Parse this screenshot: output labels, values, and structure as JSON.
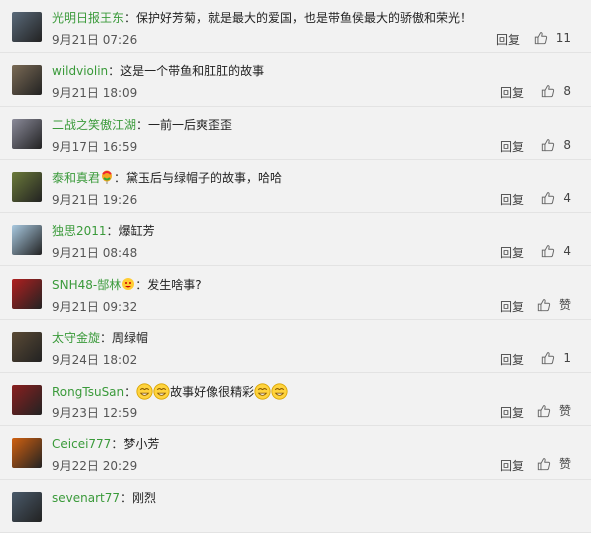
{
  "comments": [
    {
      "user": "光明日报王东",
      "sep": "：",
      "text": "保护好芳菊，就是最大的爱国，也是带鱼侯最大的骄傲和荣光！",
      "time": "9月21日 07:26",
      "reply": "回复",
      "likes": "11",
      "avatar_color": "#5a6a7a"
    },
    {
      "user": "wildviolin",
      "sep": "：",
      "text": "这是一个带鱼和肛肛的故事",
      "time": "9月21日 18:09",
      "reply": "回复",
      "likes": "8",
      "avatar_color": "#7a6a55"
    },
    {
      "user": "二战之笑傲江湖",
      "sep": "：",
      "text": "一前一后爽歪歪",
      "time": "9月17日 16:59",
      "reply": "回复",
      "likes": "8",
      "avatar_color": "#8a8a99"
    },
    {
      "user": "泰和真君",
      "sep": "：",
      "text": "黛玉后与绿帽子的故事，哈哈",
      "time": "9月21日 19:26",
      "reply": "回复",
      "likes": "4",
      "avatar_color": "#6b7a3a",
      "badge": "balloon-badge-icon"
    },
    {
      "user": "独思2011",
      "sep": "：",
      "text": "爆缸芳",
      "time": "9月21日 08:48",
      "reply": "回复",
      "likes": "4",
      "avatar_color": "#a9c9e0"
    },
    {
      "user": "SNH48-郜林",
      "sep": "：",
      "text": "发生啥事?",
      "time": "9月21日 09:32",
      "reply": "回复",
      "likes": "赞",
      "avatar_color": "#b02020",
      "badge": "vip-badge-icon"
    },
    {
      "user": "太守金旋",
      "sep": "：",
      "text": "周绿帽",
      "time": "9月24日 18:02",
      "reply": "回复",
      "likes": "1",
      "avatar_color": "#5a4a35"
    },
    {
      "user": "RongTsuSan",
      "sep": "：",
      "text": "故事好像很精彩",
      "time": "9月23日 12:59",
      "reply": "回复",
      "likes": "赞",
      "avatar_color": "#8a2020",
      "emoji": true
    },
    {
      "user": "Ceicei777",
      "sep": "：",
      "text": "梦小芳",
      "time": "9月22日 20:29",
      "reply": "回复",
      "likes": "赞",
      "avatar_color": "#d06010"
    },
    {
      "user": "sevenart77",
      "sep": "：",
      "text": "刚烈",
      "time": "",
      "reply": "",
      "likes": "",
      "avatar_color": "#4a5a6a"
    }
  ]
}
